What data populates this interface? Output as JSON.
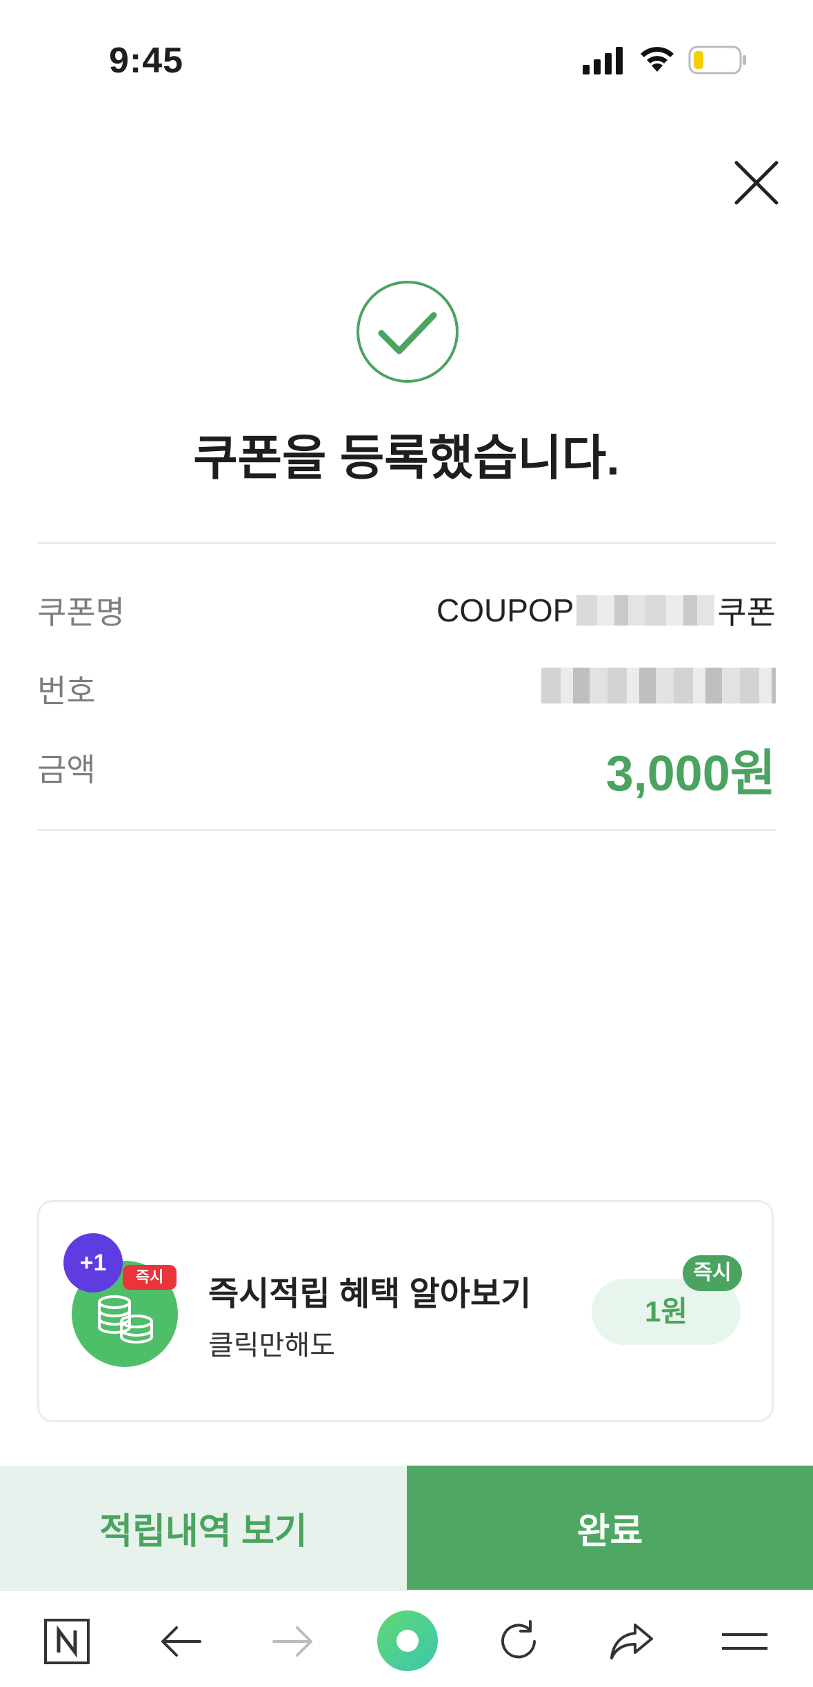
{
  "status_bar": {
    "time": "9:45"
  },
  "result": {
    "title": "쿠폰을 등록했습니다."
  },
  "details": {
    "coupon_name_label": "쿠폰명",
    "coupon_name_prefix": "COUPOP",
    "coupon_name_suffix": "쿠폰",
    "number_label": "번호",
    "amount_label": "금액",
    "amount_value": "3,000원"
  },
  "promo": {
    "plus_badge": "+1",
    "instant_badge": "즉시",
    "title": "즉시적립 혜택 알아보기",
    "subtitle": "클릭만해도",
    "reward_badge": "즉시",
    "reward_value": "1원"
  },
  "buttons": {
    "history_label": "적립내역 보기",
    "done_label": "완료"
  },
  "colors": {
    "accent_green": "#4aa45f",
    "purple_badge": "#5e3ce0",
    "red_badge": "#e8343a"
  },
  "toolbar_icons": [
    "naver-home-icon",
    "back-arrow-icon",
    "forward-arrow-icon",
    "green-dot-icon",
    "refresh-icon",
    "share-icon",
    "menu-icon"
  ]
}
